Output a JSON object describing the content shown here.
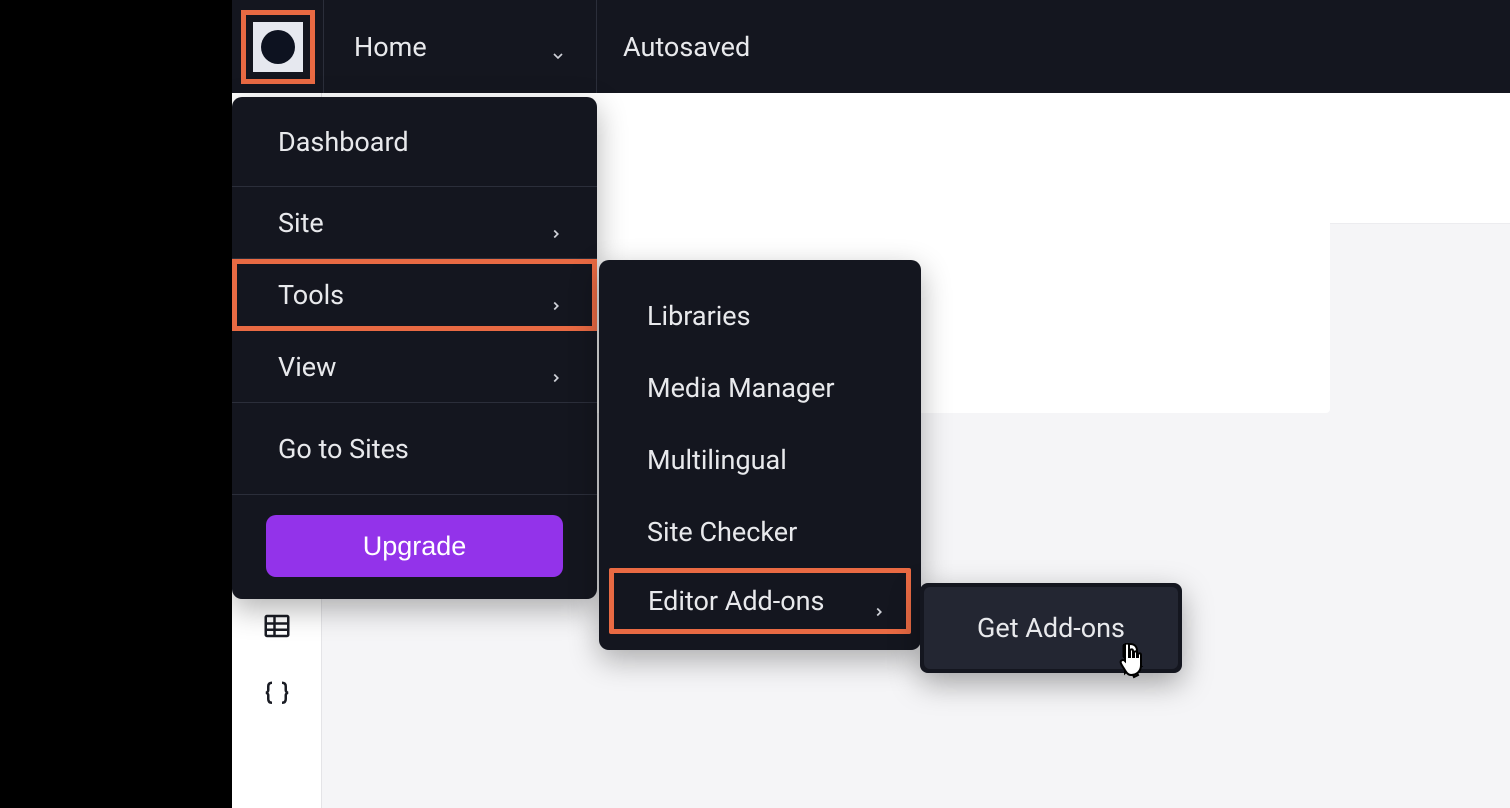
{
  "topbar": {
    "page_selector": "Home",
    "save_status": "Autosaved"
  },
  "main_menu": {
    "dashboard": "Dashboard",
    "site": "Site",
    "tools": "Tools",
    "view": "View",
    "go_to_sites": "Go to Sites",
    "upgrade": "Upgrade"
  },
  "tools_submenu": {
    "libraries": "Libraries",
    "media_manager": "Media Manager",
    "multilingual": "Multilingual",
    "site_checker": "Site Checker",
    "editor_addons": "Editor Add-ons"
  },
  "addons_submenu": {
    "get_addons": "Get Add-ons"
  },
  "highlight_color": "#e96a43",
  "upgrade_color": "#9333ea"
}
